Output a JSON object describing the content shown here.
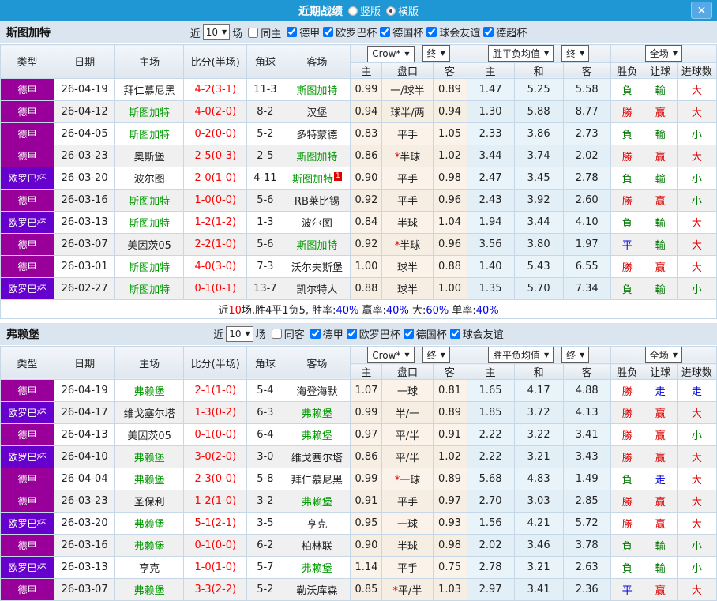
{
  "titlebar": {
    "title": "近期战绩",
    "vertical_label": "竖版",
    "horizontal_label": "横版",
    "close_glyph": "✕",
    "bar_color": "#1E97D4"
  },
  "colors": {
    "league_badge": "#990099",
    "cup_badge": "#6600CC",
    "focus_team": "#009900",
    "score": "#FF0000",
    "win": "#DD0000",
    "lose": "#007700",
    "draw": "#0000DD"
  },
  "sections": [
    {
      "team": "斯图加特",
      "filter": {
        "prefix": "近",
        "count": "10",
        "suffix": "场",
        "same_label": "同主",
        "same_checked": false,
        "leagues": [
          "德甲",
          "欧罗巴杯",
          "德国杯",
          "球会友谊",
          "德超杯"
        ]
      },
      "header": {
        "cols": [
          "类型",
          "日期",
          "主场",
          "比分(半场)",
          "角球",
          "客场"
        ],
        "company_select": "Crow*",
        "final_select": "终",
        "avg_select": "胜平负均值",
        "avg_final_select": "终",
        "scope_select": "全场",
        "sub": [
          "主",
          "盘口",
          "客",
          "主",
          "和",
          "客",
          "胜负",
          "让球",
          "进球数"
        ]
      },
      "rows": [
        {
          "type": "德甲",
          "date": "26-04-19",
          "home": "拜仁慕尼黑",
          "score": "4-2(3-1)",
          "corner": "11-3",
          "away": "斯图加特",
          "h_home": "0.99",
          "handicap": "一/球半",
          "h_away": "0.89",
          "o_home": "1.47",
          "o_draw": "5.25",
          "o_away": "5.58",
          "res": "負",
          "let": "輸",
          "goals": "大"
        },
        {
          "type": "德甲",
          "date": "26-04-12",
          "home": "斯图加特",
          "score": "4-0(2-0)",
          "corner": "8-2",
          "away": "汉堡",
          "h_home": "0.94",
          "handicap": "球半/两",
          "h_away": "0.94",
          "o_home": "1.30",
          "o_draw": "5.88",
          "o_away": "8.77",
          "res": "勝",
          "let": "赢",
          "goals": "大"
        },
        {
          "type": "德甲",
          "date": "26-04-05",
          "home": "斯图加特",
          "score": "0-2(0-0)",
          "corner": "5-2",
          "away": "多特蒙德",
          "h_home": "0.83",
          "handicap": "平手",
          "h_away": "1.05",
          "o_home": "2.33",
          "o_draw": "3.86",
          "o_away": "2.73",
          "res": "負",
          "let": "輸",
          "goals": "小"
        },
        {
          "type": "德甲",
          "date": "26-03-23",
          "home": "奥斯堡",
          "score": "2-5(0-3)",
          "corner": "2-5",
          "away": "斯图加特",
          "h_home": "0.86",
          "handicap": "*半球",
          "h_away": "1.02",
          "o_home": "3.44",
          "o_draw": "3.74",
          "o_away": "2.02",
          "res": "勝",
          "let": "赢",
          "goals": "大"
        },
        {
          "type": "欧罗巴杯",
          "date": "26-03-20",
          "home": "波尔图",
          "score": "2-0(1-0)",
          "corner": "4-11",
          "away": "斯图加特",
          "away_sup": "1",
          "h_home": "0.90",
          "handicap": "平手",
          "h_away": "0.98",
          "o_home": "2.47",
          "o_draw": "3.45",
          "o_away": "2.78",
          "res": "負",
          "let": "輸",
          "goals": "小"
        },
        {
          "type": "德甲",
          "date": "26-03-16",
          "home": "斯图加特",
          "score": "1-0(0-0)",
          "corner": "5-6",
          "away": "RB莱比锡",
          "h_home": "0.92",
          "handicap": "平手",
          "h_away": "0.96",
          "o_home": "2.43",
          "o_draw": "3.92",
          "o_away": "2.60",
          "res": "勝",
          "let": "赢",
          "goals": "小"
        },
        {
          "type": "欧罗巴杯",
          "date": "26-03-13",
          "home": "斯图加特",
          "score": "1-2(1-2)",
          "corner": "1-3",
          "away": "波尔图",
          "h_home": "0.84",
          "handicap": "半球",
          "h_away": "1.04",
          "o_home": "1.94",
          "o_draw": "3.44",
          "o_away": "4.10",
          "res": "負",
          "let": "輸",
          "goals": "大"
        },
        {
          "type": "德甲",
          "date": "26-03-07",
          "home": "美因茨05",
          "score": "2-2(1-0)",
          "corner": "5-6",
          "away": "斯图加特",
          "h_home": "0.92",
          "handicap": "*半球",
          "h_away": "0.96",
          "o_home": "3.56",
          "o_draw": "3.80",
          "o_away": "1.97",
          "res": "平",
          "let": "輸",
          "goals": "大"
        },
        {
          "type": "德甲",
          "date": "26-03-01",
          "home": "斯图加特",
          "score": "4-0(3-0)",
          "corner": "7-3",
          "away": "沃尔夫斯堡",
          "h_home": "1.00",
          "handicap": "球半",
          "h_away": "0.88",
          "o_home": "1.40",
          "o_draw": "5.43",
          "o_away": "6.55",
          "res": "勝",
          "let": "赢",
          "goals": "大"
        },
        {
          "type": "欧罗巴杯",
          "date": "26-02-27",
          "home": "斯图加特",
          "score": "0-1(0-1)",
          "corner": "13-7",
          "away": "凯尔特人",
          "h_home": "0.88",
          "handicap": "球半",
          "h_away": "1.00",
          "o_home": "1.35",
          "o_draw": "5.70",
          "o_away": "7.34",
          "res": "負",
          "let": "輸",
          "goals": "小"
        }
      ],
      "summary": [
        [
          "近",
          "k"
        ],
        [
          "10",
          "r"
        ],
        [
          "场,胜4平1负5, 胜率:",
          "k"
        ],
        [
          "40%",
          "b"
        ],
        [
          " 赢率:",
          "k"
        ],
        [
          "40%",
          "b"
        ],
        [
          " 大:",
          "k"
        ],
        [
          "60%",
          "b"
        ],
        [
          " 单率:",
          "k"
        ],
        [
          "40%",
          "b"
        ]
      ]
    },
    {
      "team": "弗赖堡",
      "filter": {
        "prefix": "近",
        "count": "10",
        "suffix": "场",
        "same_label": "同客",
        "same_checked": false,
        "leagues": [
          "德甲",
          "欧罗巴杯",
          "德国杯",
          "球会友谊"
        ]
      },
      "header": {
        "cols": [
          "类型",
          "日期",
          "主场",
          "比分(半场)",
          "角球",
          "客场"
        ],
        "company_select": "Crow*",
        "final_select": "终",
        "avg_select": "胜平负均值",
        "avg_final_select": "终",
        "scope_select": "全场",
        "sub": [
          "主",
          "盘口",
          "客",
          "主",
          "和",
          "客",
          "胜负",
          "让球",
          "进球数"
        ]
      },
      "rows": [
        {
          "type": "德甲",
          "date": "26-04-19",
          "home": "弗赖堡",
          "score": "2-1(1-0)",
          "corner": "5-4",
          "away": "海登海默",
          "h_home": "1.07",
          "handicap": "一球",
          "h_away": "0.81",
          "o_home": "1.65",
          "o_draw": "4.17",
          "o_away": "4.88",
          "res": "勝",
          "let": "走",
          "goals": "走"
        },
        {
          "type": "欧罗巴杯",
          "date": "26-04-17",
          "home": "维戈塞尔塔",
          "score": "1-3(0-2)",
          "corner": "6-3",
          "away": "弗赖堡",
          "h_home": "0.99",
          "handicap": "半/一",
          "h_away": "0.89",
          "o_home": "1.85",
          "o_draw": "3.72",
          "o_away": "4.13",
          "res": "勝",
          "let": "赢",
          "goals": "大"
        },
        {
          "type": "德甲",
          "date": "26-04-13",
          "home": "美因茨05",
          "score": "0-1(0-0)",
          "corner": "6-4",
          "away": "弗赖堡",
          "h_home": "0.97",
          "handicap": "平/半",
          "h_away": "0.91",
          "o_home": "2.22",
          "o_draw": "3.22",
          "o_away": "3.41",
          "res": "勝",
          "let": "赢",
          "goals": "小"
        },
        {
          "type": "欧罗巴杯",
          "date": "26-04-10",
          "home": "弗赖堡",
          "score": "3-0(2-0)",
          "corner": "3-0",
          "away": "维戈塞尔塔",
          "h_home": "0.86",
          "handicap": "平/半",
          "h_away": "1.02",
          "o_home": "2.22",
          "o_draw": "3.21",
          "o_away": "3.43",
          "res": "勝",
          "let": "赢",
          "goals": "大"
        },
        {
          "type": "德甲",
          "date": "26-04-04",
          "home": "弗赖堡",
          "score": "2-3(0-0)",
          "corner": "5-8",
          "away": "拜仁慕尼黑",
          "h_home": "0.99",
          "handicap": "*一球",
          "h_away": "0.89",
          "o_home": "5.68",
          "o_draw": "4.83",
          "o_away": "1.49",
          "res": "負",
          "let": "走",
          "goals": "大"
        },
        {
          "type": "德甲",
          "date": "26-03-23",
          "home": "圣保利",
          "score": "1-2(1-0)",
          "corner": "3-2",
          "away": "弗赖堡",
          "h_home": "0.91",
          "handicap": "平手",
          "h_away": "0.97",
          "o_home": "2.70",
          "o_draw": "3.03",
          "o_away": "2.85",
          "res": "勝",
          "let": "赢",
          "goals": "大"
        },
        {
          "type": "欧罗巴杯",
          "date": "26-03-20",
          "home": "弗赖堡",
          "score": "5-1(2-1)",
          "corner": "3-5",
          "away": "亨克",
          "h_home": "0.95",
          "handicap": "一球",
          "h_away": "0.93",
          "o_home": "1.56",
          "o_draw": "4.21",
          "o_away": "5.72",
          "res": "勝",
          "let": "赢",
          "goals": "大"
        },
        {
          "type": "德甲",
          "date": "26-03-16",
          "home": "弗赖堡",
          "score": "0-1(0-0)",
          "corner": "6-2",
          "away": "柏林联",
          "h_home": "0.90",
          "handicap": "半球",
          "h_away": "0.98",
          "o_home": "2.02",
          "o_draw": "3.46",
          "o_away": "3.78",
          "res": "負",
          "let": "輸",
          "goals": "小"
        },
        {
          "type": "欧罗巴杯",
          "date": "26-03-13",
          "home": "亨克",
          "score": "1-0(1-0)",
          "corner": "5-7",
          "away": "弗赖堡",
          "h_home": "1.14",
          "handicap": "平手",
          "h_away": "0.75",
          "o_home": "2.78",
          "o_draw": "3.21",
          "o_away": "2.63",
          "res": "負",
          "let": "輸",
          "goals": "小"
        },
        {
          "type": "德甲",
          "date": "26-03-07",
          "home": "弗赖堡",
          "score": "3-3(2-2)",
          "corner": "5-2",
          "away": "勒沃库森",
          "h_home": "0.85",
          "handicap": "*平/半",
          "h_away": "1.03",
          "o_home": "2.97",
          "o_draw": "3.41",
          "o_away": "2.36",
          "res": "平",
          "let": "赢",
          "goals": "大"
        }
      ]
    }
  ]
}
